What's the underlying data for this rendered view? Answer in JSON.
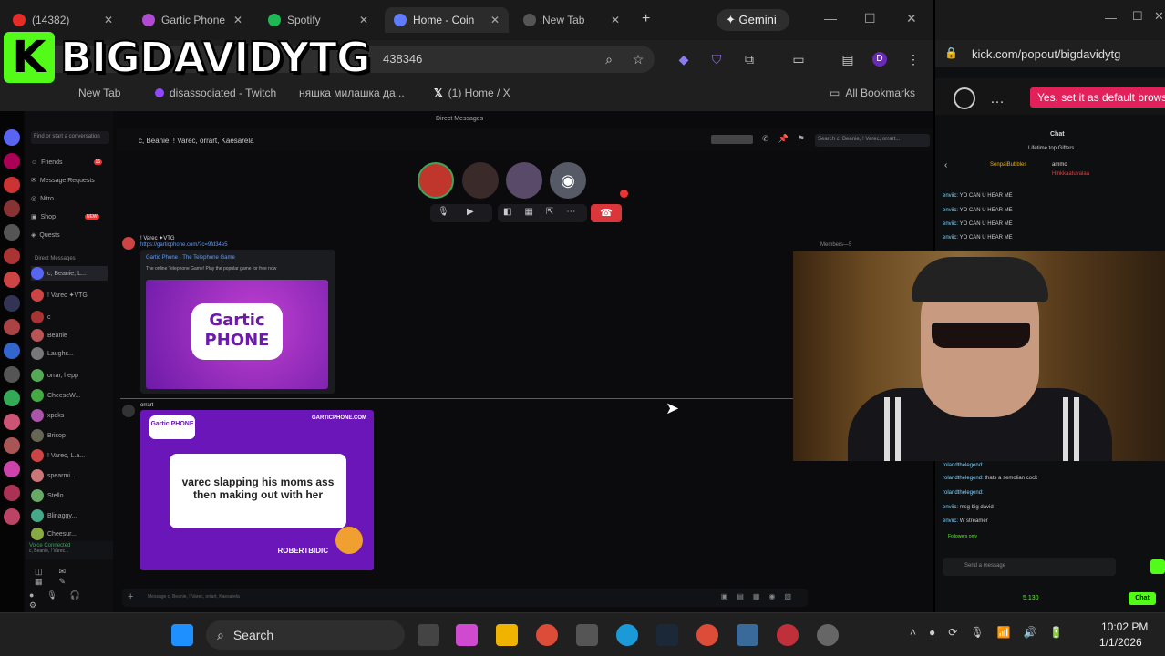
{
  "streamer_overlay": {
    "logo_letter": "K",
    "name": "BIGDAVIDYTG"
  },
  "browser": {
    "tabs": [
      {
        "label": "(14382)"
      },
      {
        "label": "Gartic Phone"
      },
      {
        "label": "Spotify"
      },
      {
        "label": "Home - Coin"
      },
      {
        "label": "New Tab"
      }
    ],
    "gemini_label": "Gemini",
    "address_partial": "438346",
    "bookmarks": [
      "New Tab",
      "disassociated - Twitch",
      "няшка милашка да...",
      "(1) Home / X"
    ],
    "all_bookmarks": "All Bookmarks",
    "profile_initial": "D"
  },
  "discord": {
    "top_title": "Direct Messages",
    "find_placeholder": "Find or start a conversation",
    "nav": [
      "Friends",
      "Message Requests",
      "Nitro",
      "Shop",
      "Quests"
    ],
    "friends_badge": "16",
    "shop_badge": "NEW",
    "dm_header": "Direct Messages",
    "dm_rows": [
      "c, Beanie, L...",
      "! Varec ✦VTG",
      "c",
      "Beanie",
      "Laughs...",
      "orrar, hepp",
      "CheeseW...",
      "xpeks",
      "Brisop",
      "! Varec, L.a...",
      "spearmi...",
      "Stello",
      "Blinaggy...",
      "Cheesur..."
    ],
    "voice_status": "Voice Connected",
    "voice_channel": "c, Beanie, ! Varec...",
    "channel_title": "c, Beanie, ! Varec, orrart, Kaesarela",
    "search_placeholder": "Search c, Beanie, ! Varec, orrart...",
    "message1_author": "! Varec ✦VTG",
    "message1_link": "https://garticphone.com/?c=9fd34e5",
    "embed_title": "Gartic Phone - The Telephone Game",
    "embed_desc": "The online Telephone Game! Play the popular game for free now",
    "gartic_logo": "Gartic PHONE",
    "message2_author": "orrart",
    "gartic_site": "GARTICPHONE.COM",
    "drawing_prompt": "varec slapping his moms ass then making out with her",
    "prompt_author": "ROBERTBIDIC",
    "members_label": "Members—5",
    "message_placeholder": "Message c, Beanie, ! Varec, orrart, Kaesarela"
  },
  "kick": {
    "url": "kick.com/popout/bigdavidytg",
    "default_browser_btn": "Yes, set it as default browser",
    "chat_title": "Chat",
    "gifters_title": "Lifetime top Gifters",
    "gifters": [
      {
        "name": "SenpaiBubbles"
      },
      {
        "name": "ammo"
      },
      {
        "name": "Hinkkaatuvalaa"
      }
    ],
    "chat_top": [
      {
        "user": "enviic:",
        "text": "YO CAN U HEAR ME"
      },
      {
        "user": "enviic:",
        "text": "YO CAN U HEAR ME"
      },
      {
        "user": "enviic:",
        "text": "YO CAN U HEAR ME"
      },
      {
        "user": "enviic:",
        "text": "YO CAN U HEAR ME"
      }
    ],
    "chat_bottom": [
      {
        "user": "rolandthelegend:",
        "text": ""
      },
      {
        "user": "rolandthelegend:",
        "text": "thats a semolian cock"
      },
      {
        "user": "rolandthelegend:",
        "text": ""
      },
      {
        "user": "enviic:",
        "text": "msg big david"
      },
      {
        "user": "enviic:",
        "text": "W streamer"
      }
    ],
    "followers_only": "Followers only",
    "send_placeholder": "Send a message",
    "points": "5,130",
    "chat_btn": "Chat"
  },
  "taskbar": {
    "search_label": "Search",
    "time": "10:02 PM",
    "date": "1/1/2026"
  }
}
